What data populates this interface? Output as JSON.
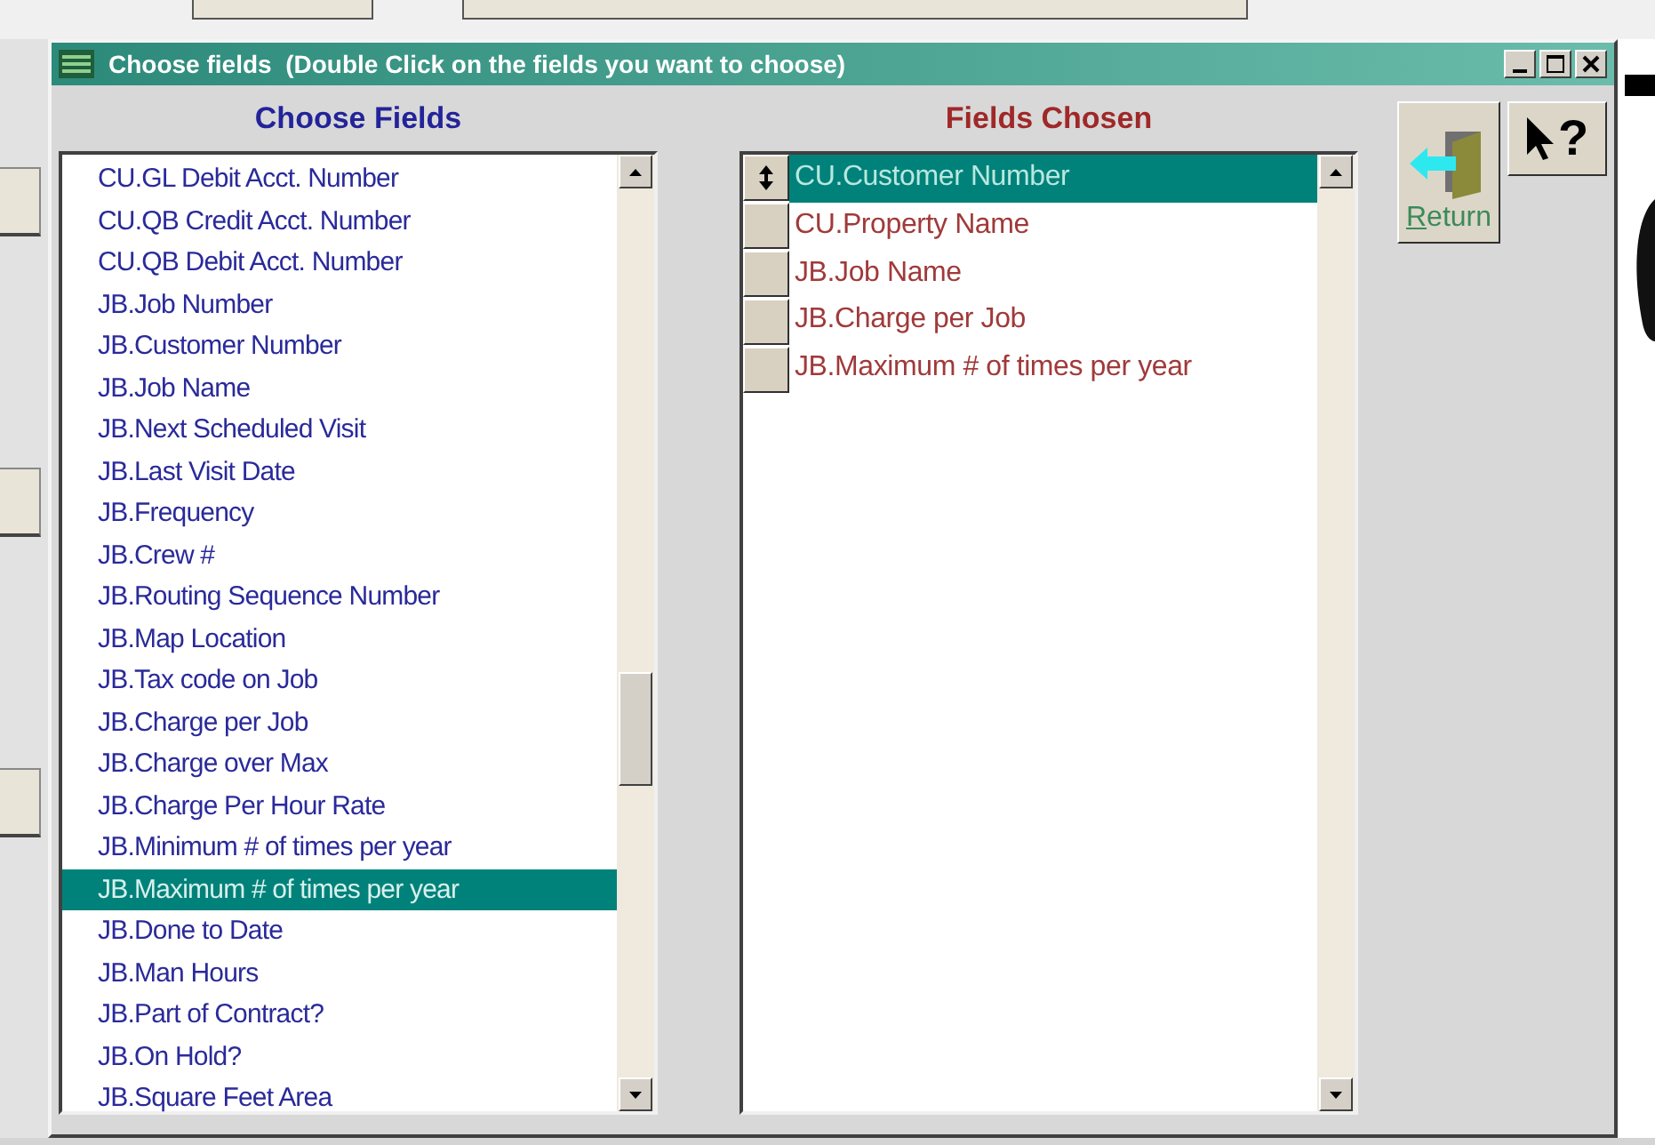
{
  "window": {
    "title": "Choose fields  (Double Click on the fields you want to choose)"
  },
  "available": {
    "heading": "Choose Fields",
    "items": [
      {
        "label": "CU.GL Debit Acct. Number",
        "selected": false
      },
      {
        "label": "CU.QB Credit Acct. Number",
        "selected": false
      },
      {
        "label": "CU.QB Debit  Acct. Number",
        "selected": false
      },
      {
        "label": "JB.Job Number",
        "selected": false
      },
      {
        "label": "JB.Customer Number",
        "selected": false
      },
      {
        "label": "JB.Job Name",
        "selected": false
      },
      {
        "label": "JB.Next Scheduled Visit",
        "selected": false
      },
      {
        "label": "JB.Last Visit Date",
        "selected": false
      },
      {
        "label": "JB.Frequency",
        "selected": false
      },
      {
        "label": "JB.Crew #",
        "selected": false
      },
      {
        "label": "JB.Routing Sequence Number",
        "selected": false
      },
      {
        "label": "JB.Map Location",
        "selected": false
      },
      {
        "label": "JB.Tax code on Job",
        "selected": false
      },
      {
        "label": "JB.Charge per Job",
        "selected": false
      },
      {
        "label": "JB.Charge over Max",
        "selected": false
      },
      {
        "label": "JB.Charge Per Hour Rate",
        "selected": false
      },
      {
        "label": "JB.Minimum # of times per year",
        "selected": false
      },
      {
        "label": "JB.Maximum # of times per year",
        "selected": true
      },
      {
        "label": "JB.Done to Date",
        "selected": false
      },
      {
        "label": "JB.Man Hours",
        "selected": false
      },
      {
        "label": "JB.Part of Contract?",
        "selected": false
      },
      {
        "label": "JB.On Hold?",
        "selected": false
      },
      {
        "label": "JB.Square Feet Area",
        "selected": false
      }
    ]
  },
  "chosen": {
    "heading": "Fields Chosen",
    "items": [
      {
        "label": "CU.Customer Number",
        "selected": true
      },
      {
        "label": "CU.Property Name",
        "selected": false
      },
      {
        "label": "JB.Job Name",
        "selected": false
      },
      {
        "label": "JB.Charge per Job",
        "selected": false
      },
      {
        "label": "JB.Maximum # of times per year",
        "selected": false
      }
    ]
  },
  "return_button": {
    "label": "Return"
  },
  "help_button": {
    "glyph": "?"
  }
}
